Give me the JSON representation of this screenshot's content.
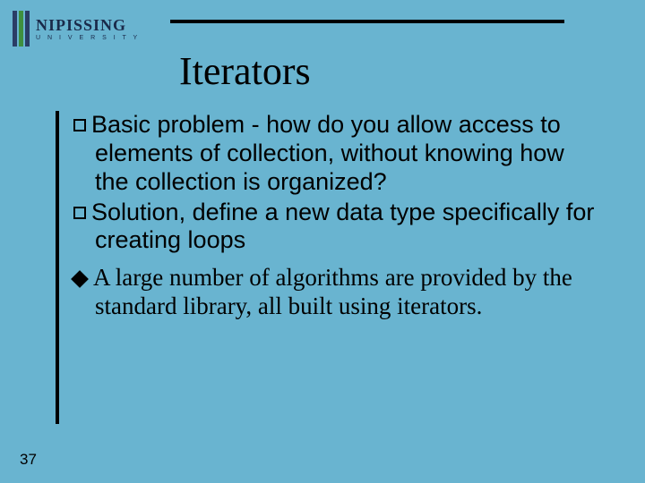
{
  "logo": {
    "name": "NIPISSING",
    "sub": "U N I V E R S I T Y"
  },
  "title": "Iterators",
  "bullets": [
    {
      "marker": "square",
      "text": "Basic problem - how do you allow access to elements of collection, without knowing how the collection is organized?",
      "font": "sans"
    },
    {
      "marker": "square",
      "text": "Solution, define a new data type specifically for creating loops",
      "font": "sans"
    },
    {
      "marker": "diamond",
      "text": "A large number of algorithms are provided by the standard library, all built using iterators.",
      "font": "serif"
    }
  ],
  "page_number": "37"
}
